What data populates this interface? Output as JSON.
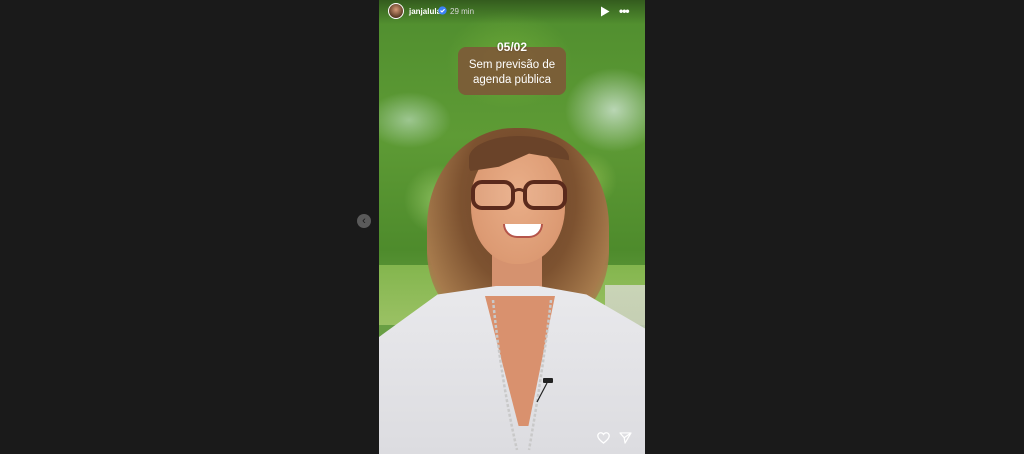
{
  "story": {
    "username": "janjalula",
    "timestamp": "29 min",
    "sticker": {
      "date": "05/02",
      "line1": "Sem previsão de",
      "line2": "agenda pública"
    }
  },
  "icons": {
    "prev": "chevron-left-icon",
    "verified": "verified-badge-icon",
    "play": "play-icon",
    "more": "more-icon",
    "like": "heart-icon",
    "share": "send-icon"
  },
  "colors": {
    "page_background": "#1a1a1a",
    "sticker_background": "#7d5a37",
    "verified": "#3b82f6"
  }
}
